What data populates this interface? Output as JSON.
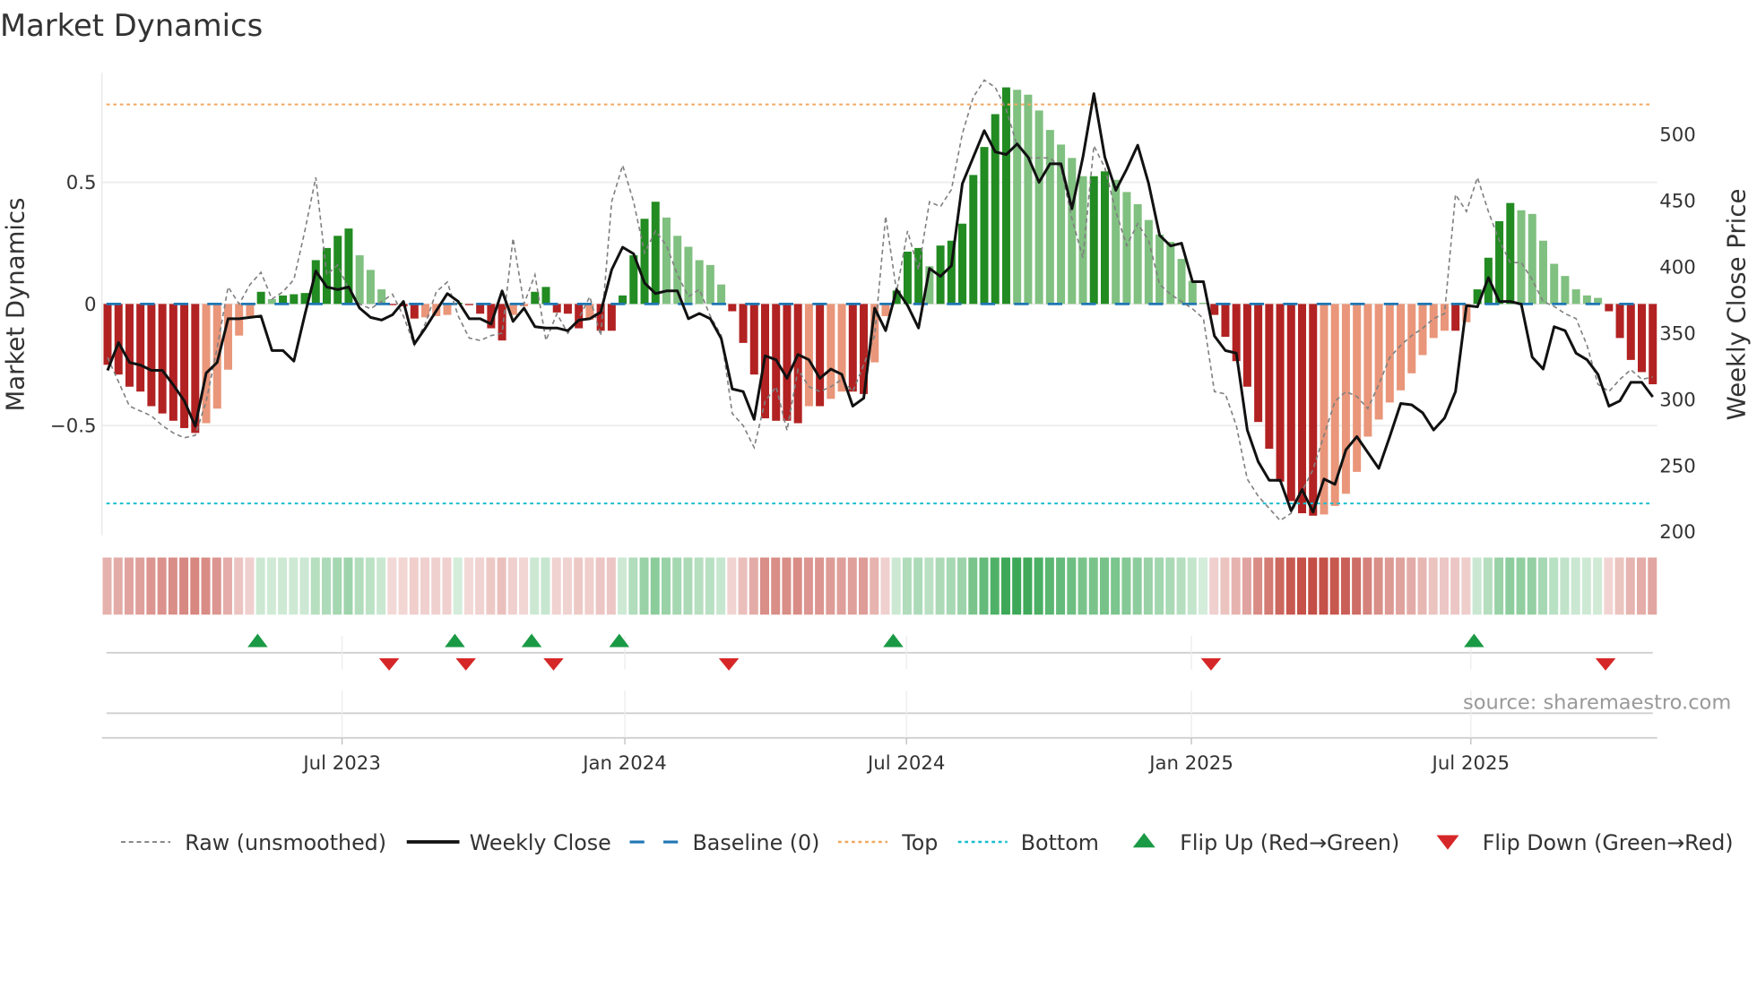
{
  "title": "Market Dynamics",
  "source": "source: sharemaestro.com",
  "chart_data": {
    "type": "bar",
    "title": "Market Dynamics",
    "ylabel_left": "Market Dynamics",
    "ylabel_right": "Weekly Close Price",
    "frequency": "weekly",
    "x_ticks": [
      {
        "label": "Jul 2023",
        "week": 21.4
      },
      {
        "label": "Jan 2024",
        "week": 47.2
      },
      {
        "label": "Jul 2024",
        "week": 72.9
      },
      {
        "label": "Jan 2025",
        "week": 98.9
      },
      {
        "label": "Jul 2025",
        "week": 124.4
      }
    ],
    "y_left": {
      "range": [
        -0.95,
        0.95
      ],
      "grid": true,
      "ticks": [
        {
          "value": 0.5,
          "label": "0.5"
        },
        {
          "value": 0,
          "label": "0"
        },
        {
          "value": -0.5,
          "label": "−0.5"
        }
      ]
    },
    "y_right": {
      "range": [
        196.6,
        545.7
      ],
      "ticks": [
        {
          "value": 500,
          "label": "500"
        },
        {
          "value": 450,
          "label": "450"
        },
        {
          "value": 400,
          "label": "400"
        },
        {
          "value": 350,
          "label": "350"
        },
        {
          "value": 300,
          "label": "300"
        },
        {
          "value": 250,
          "label": "250"
        },
        {
          "value": 200,
          "label": "200"
        }
      ]
    },
    "top_level": 0.82,
    "bottom_level": -0.82,
    "baseline": 0,
    "dynamics": [
      -0.25,
      -0.29,
      -0.34,
      -0.36,
      -0.42,
      -0.45,
      -0.48,
      -0.51,
      -0.53,
      -0.49,
      -0.43,
      -0.27,
      -0.13,
      -0.05,
      0.05,
      0.02,
      0.035,
      0.04,
      0.045,
      0.18,
      0.23,
      0.28,
      0.31,
      0.2,
      0.14,
      0.06,
      -0.005,
      -0.01,
      -0.06,
      -0.055,
      -0.05,
      -0.045,
      0.005,
      -0.005,
      -0.04,
      -0.1,
      -0.15,
      -0.045,
      -0.01,
      0.05,
      0.07,
      -0.035,
      -0.04,
      -0.1,
      -0.065,
      -0.11,
      -0.11,
      0.035,
      0.2,
      0.35,
      0.42,
      0.355,
      0.28,
      0.235,
      0.18,
      0.16,
      0.08,
      -0.03,
      -0.16,
      -0.29,
      -0.47,
      -0.48,
      -0.48,
      -0.49,
      -0.42,
      -0.42,
      -0.39,
      -0.36,
      -0.36,
      -0.37,
      -0.24,
      -0.05,
      0.055,
      0.215,
      0.23,
      0.155,
      0.24,
      0.26,
      0.33,
      0.53,
      0.645,
      0.78,
      0.89,
      0.88,
      0.86,
      0.795,
      0.715,
      0.655,
      0.6,
      0.525,
      0.525,
      0.545,
      0.51,
      0.46,
      0.41,
      0.345,
      0.285,
      0.255,
      0.185,
      0.095,
      0.005,
      -0.045,
      -0.135,
      -0.235,
      -0.34,
      -0.485,
      -0.595,
      -0.73,
      -0.81,
      -0.86,
      -0.87,
      -0.865,
      -0.83,
      -0.78,
      -0.69,
      -0.545,
      -0.475,
      -0.405,
      -0.355,
      -0.285,
      -0.21,
      -0.14,
      -0.11,
      -0.11,
      -0.075,
      0.06,
      0.19,
      0.34,
      0.415,
      0.385,
      0.37,
      0.26,
      0.165,
      0.115,
      0.06,
      0.035,
      0.025,
      -0.03,
      -0.14,
      -0.23,
      -0.28,
      -0.33
    ],
    "raw": [
      -0.22,
      -0.32,
      -0.42,
      -0.44,
      -0.46,
      -0.5,
      -0.53,
      -0.55,
      -0.54,
      -0.4,
      -0.18,
      0.07,
      0.0,
      0.08,
      0.13,
      0.02,
      0.05,
      0.1,
      0.3,
      0.52,
      0.12,
      0.16,
      0.06,
      0.0,
      -0.02,
      0.01,
      0.04,
      -0.05,
      -0.17,
      -0.08,
      0.05,
      0.09,
      -0.05,
      -0.14,
      -0.15,
      -0.13,
      -0.12,
      0.27,
      0.0,
      0.12,
      -0.15,
      -0.04,
      -0.12,
      -0.06,
      0.03,
      -0.13,
      0.42,
      0.57,
      0.42,
      0.21,
      0.3,
      0.24,
      0.12,
      0.03,
      0.06,
      -0.05,
      -0.13,
      -0.45,
      -0.5,
      -0.59,
      -0.4,
      -0.34,
      -0.52,
      -0.27,
      -0.34,
      -0.36,
      -0.34,
      -0.31,
      -0.36,
      -0.25,
      -0.13,
      0.36,
      0.05,
      0.3,
      0.14,
      0.42,
      0.4,
      0.47,
      0.7,
      0.85,
      0.92,
      0.89,
      0.8,
      0.65,
      0.6,
      0.6,
      0.6,
      0.56,
      0.35,
      0.19,
      0.65,
      0.56,
      0.38,
      0.24,
      0.33,
      0.26,
      0.08,
      0.04,
      0.01,
      -0.02,
      -0.06,
      -0.36,
      -0.37,
      -0.5,
      -0.72,
      -0.79,
      -0.84,
      -0.89,
      -0.86,
      -0.77,
      -0.68,
      -0.54,
      -0.4,
      -0.36,
      -0.38,
      -0.43,
      -0.33,
      -0.22,
      -0.17,
      -0.13,
      -0.1,
      -0.06,
      -0.04,
      0.45,
      0.38,
      0.52,
      0.38,
      0.26,
      0.17,
      0.17,
      0.1,
      0.01,
      -0.01,
      -0.04,
      -0.06,
      -0.17,
      -0.33,
      -0.36,
      -0.31,
      -0.27,
      -0.31,
      -0.3
    ],
    "weekly_close": [
      321,
      342,
      327,
      325,
      321,
      321,
      310,
      298,
      279,
      319,
      327,
      360,
      360,
      361,
      362,
      336,
      336,
      328,
      363,
      396,
      384,
      382,
      384,
      368,
      361,
      359,
      363,
      373,
      341,
      353,
      366,
      379,
      373,
      360,
      360,
      356,
      381,
      358,
      368,
      354,
      353,
      353,
      351,
      359,
      360,
      365,
      397,
      414,
      409,
      387,
      379,
      381,
      381,
      360,
      364,
      360,
      345,
      307,
      305,
      284,
      332,
      329,
      315,
      333,
      329,
      315,
      322,
      318,
      294,
      300,
      368,
      351,
      382,
      370,
      353,
      398,
      392,
      400,
      462,
      482,
      502,
      486,
      484,
      492,
      482,
      463,
      477,
      477,
      443,
      482,
      530,
      482,
      457,
      473,
      491,
      462,
      423,
      415,
      417,
      388,
      388,
      347,
      336,
      334,
      276,
      252,
      238,
      238,
      215,
      231,
      214,
      239,
      235,
      261,
      271,
      259,
      247,
      271,
      296,
      295,
      289,
      276,
      285,
      305,
      370,
      369,
      391,
      373,
      373,
      371,
      331,
      322,
      354,
      351,
      334,
      329,
      318,
      294,
      298,
      312,
      312,
      301
    ],
    "flip_up_weeks": [
      14,
      32,
      39,
      47,
      72,
      125
    ],
    "flip_down_weeks": [
      26,
      33,
      41,
      57,
      101,
      137
    ],
    "colors": {
      "up_strong": "#228b22",
      "up_weak": "#80c080",
      "down_strong": "#b22222",
      "down_weak": "#e9967a",
      "raw": "#808080",
      "close": "#111111",
      "baseline": "#1f77b4",
      "top": "#f0a860",
      "bottom": "#17becf",
      "flip_up": "#1a9a45",
      "flip_down": "#d62728",
      "strip_green": "40,160,70",
      "strip_red": "190,60,50"
    },
    "legend": [
      {
        "label": "Raw (unsmoothed)"
      },
      {
        "label": "Weekly Close"
      },
      {
        "label": "Baseline (0)"
      },
      {
        "label": "Top"
      },
      {
        "label": "Bottom"
      },
      {
        "label": "Flip Up (Red→Green)"
      },
      {
        "label": "Flip Down (Green→Red)"
      }
    ],
    "legend_placement": "bottom"
  }
}
